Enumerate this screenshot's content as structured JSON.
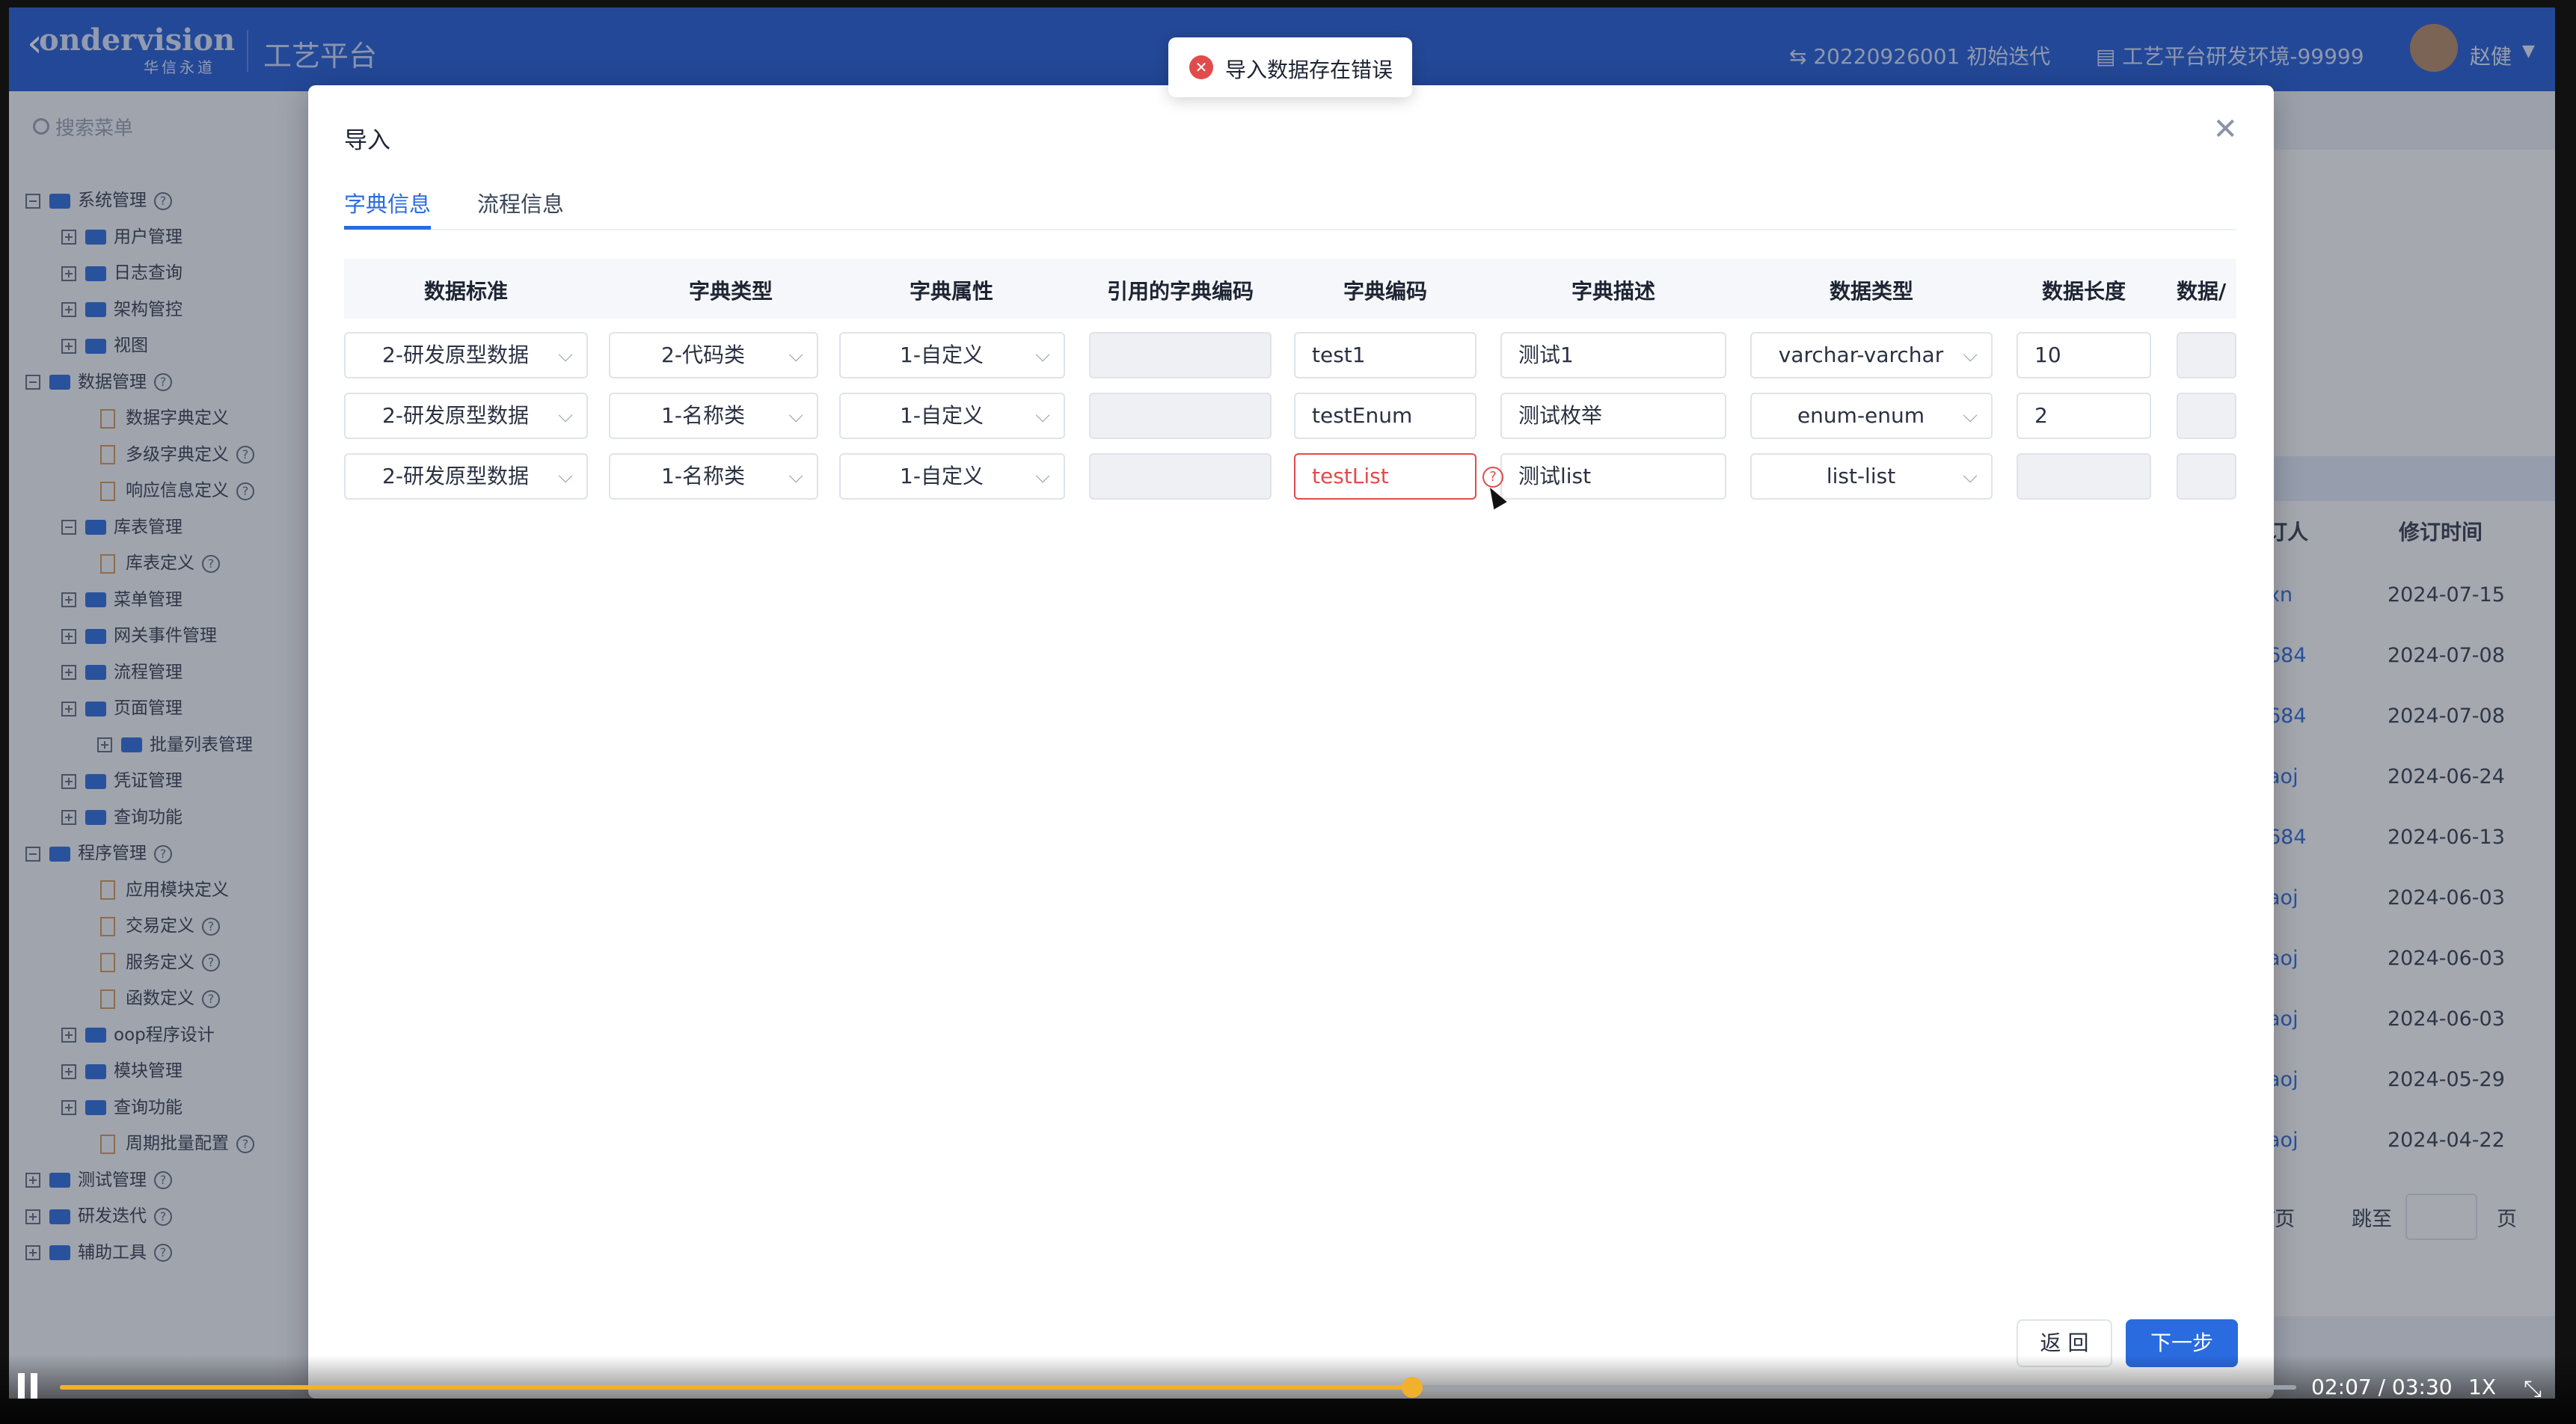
{
  "header": {
    "logo": "ondervision",
    "logo_sub": "华信永道",
    "platform": "工艺平台",
    "iteration": "⇆ 20220926001 初始迭代",
    "environment": "工艺平台研发环境-99999",
    "user": "赵健"
  },
  "sidebar": {
    "search_placeholder": "搜索菜单",
    "items": [
      {
        "label": "系统管理",
        "icon": "folder-icon",
        "expanded": true,
        "help": true
      },
      {
        "label": "用户管理",
        "icon": "folder-icon"
      },
      {
        "label": "日志查询",
        "icon": "folder-icon"
      },
      {
        "label": "架构管控",
        "icon": "folder-icon"
      },
      {
        "label": "视图",
        "icon": "folder-icon"
      },
      {
        "label": "数据管理",
        "icon": "folder-icon",
        "expanded": true,
        "help": true
      },
      {
        "label": "数据字典定义",
        "icon": "doc-icon"
      },
      {
        "label": "多级字典定义",
        "icon": "doc-icon",
        "help": true
      },
      {
        "label": "响应信息定义",
        "icon": "doc-icon",
        "help": true
      },
      {
        "label": "库表管理",
        "icon": "folder-icon",
        "expanded": true
      },
      {
        "label": "库表定义",
        "icon": "doc-icon",
        "help": true
      },
      {
        "label": "菜单管理",
        "icon": "folder-icon"
      },
      {
        "label": "网关事件管理",
        "icon": "folder-icon"
      },
      {
        "label": "流程管理",
        "icon": "folder-icon"
      },
      {
        "label": "页面管理",
        "icon": "folder-icon"
      },
      {
        "label": "批量列表管理",
        "icon": "folder-icon"
      },
      {
        "label": "凭证管理",
        "icon": "folder-icon"
      },
      {
        "label": "查询功能",
        "icon": "folder-icon"
      },
      {
        "label": "程序管理",
        "icon": "folder-icon",
        "expanded": true,
        "help": true
      },
      {
        "label": "应用模块定义",
        "icon": "doc-icon"
      },
      {
        "label": "交易定义",
        "icon": "doc-icon",
        "help": true
      },
      {
        "label": "服务定义",
        "icon": "doc-icon",
        "help": true
      },
      {
        "label": "函数定义",
        "icon": "doc-icon",
        "help": true
      },
      {
        "label": "oop程序设计",
        "icon": "folder-icon"
      },
      {
        "label": "模块管理",
        "icon": "folder-icon"
      },
      {
        "label": "查询功能",
        "icon": "folder-icon"
      },
      {
        "label": "周期批量配置",
        "icon": "doc-icon",
        "help": true
      },
      {
        "label": "测试管理",
        "icon": "folder-icon",
        "help": true
      },
      {
        "label": "研发迭代",
        "icon": "folder-icon",
        "help": true
      },
      {
        "label": "辅助工具",
        "icon": "folder-icon",
        "help": true
      }
    ]
  },
  "background_table": {
    "headers": [
      "订人",
      "修订时间"
    ],
    "rows": [
      {
        "who": "xn",
        "date": "2024-07-15"
      },
      {
        "who": "684",
        "date": "2024-07-08"
      },
      {
        "who": "684",
        "date": "2024-07-08"
      },
      {
        "who": "aoj",
        "date": "2024-06-24"
      },
      {
        "who": "684",
        "date": "2024-06-13"
      },
      {
        "who": "aoj",
        "date": "2024-06-03"
      },
      {
        "who": "aoj",
        "date": "2024-06-03"
      },
      {
        "who": "aoj",
        "date": "2024-06-03"
      },
      {
        "who": "aoj",
        "date": "2024-05-29"
      },
      {
        "who": "aoj",
        "date": "2024-04-22"
      }
    ],
    "pager_suffix": "/页",
    "jump_label": "跳至",
    "page_label": "页"
  },
  "toast": {
    "message": "导入数据存在错误"
  },
  "modal": {
    "title": "导入",
    "tabs": [
      "字典信息",
      "流程信息"
    ],
    "active_tab": 0,
    "columns": [
      "数据标准",
      "字典类型",
      "字典属性",
      "引用的字典编码",
      "字典编码",
      "字典描述",
      "数据类型",
      "数据长度",
      "数据/"
    ],
    "rows": [
      {
        "standard": "2-研发原型数据",
        "dict_type": "2-代码类",
        "attr": "1-自定义",
        "ref_code": "",
        "code": "test1",
        "desc": "测试1",
        "data_type": "varchar-varchar",
        "length": "10",
        "extra": ""
      },
      {
        "standard": "2-研发原型数据",
        "dict_type": "1-名称类",
        "attr": "1-自定义",
        "ref_code": "",
        "code": "testEnum",
        "desc": "测试枚举",
        "data_type": "enum-enum",
        "length": "2",
        "extra": ""
      },
      {
        "standard": "2-研发原型数据",
        "dict_type": "1-名称类",
        "attr": "1-自定义",
        "ref_code": "",
        "code": "testList",
        "desc": "测试list",
        "data_type": "list-list",
        "length": "",
        "extra": "",
        "code_error": true
      }
    ],
    "back_label": "返 回",
    "next_label": "下一步"
  },
  "player": {
    "time": "02:07 / 03:30",
    "progress": 0.6047,
    "speed": "1X"
  }
}
